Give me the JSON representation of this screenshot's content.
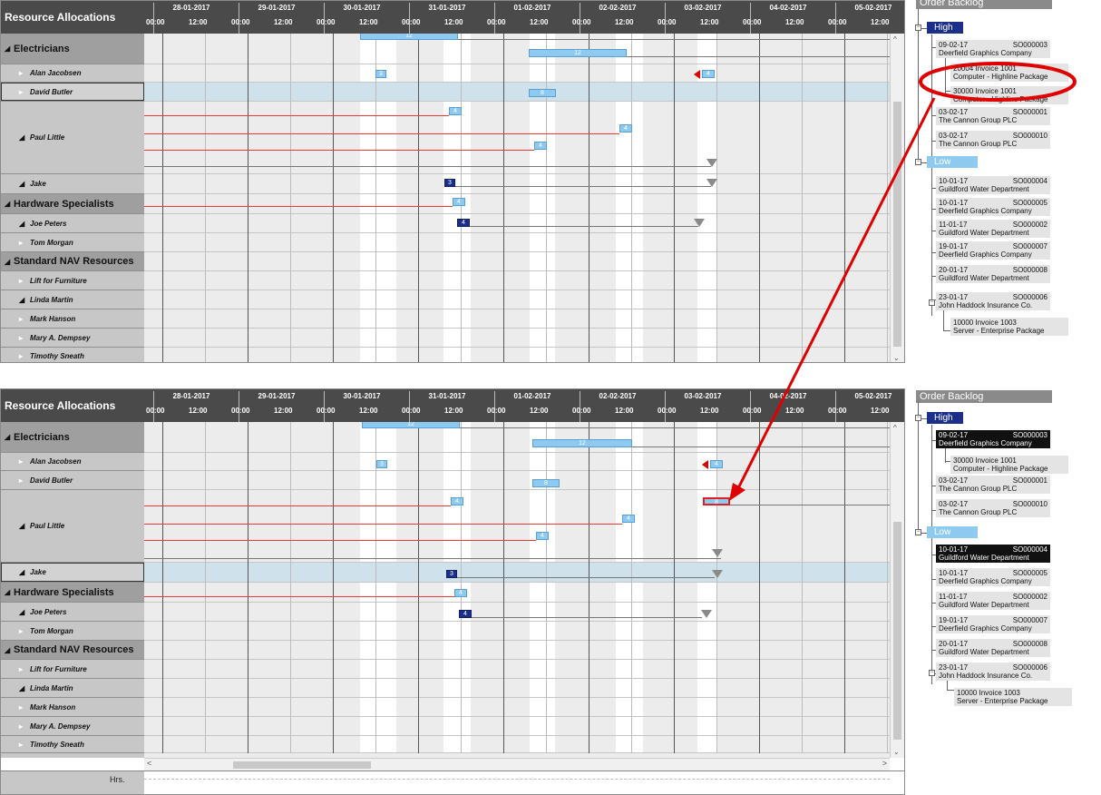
{
  "top": {
    "resource_header": "Resource Allocations",
    "day_labels": [
      "28-01-2017",
      "29-01-2017",
      "30-01-2017",
      "31-01-2017",
      "01-02-2017",
      "02-02-2017",
      "03-02-2017",
      "04-02-2017",
      "05-02-2017"
    ],
    "time_labels": [
      "00:00",
      "12:00",
      "00:00",
      "12:00",
      "00:00",
      "12:00",
      "00:00",
      "12:00",
      "00:00",
      "12:00",
      "00:00",
      "12:00",
      "00:00",
      "12:00",
      "00:00",
      "12:00",
      "00:00",
      "12:00"
    ],
    "rows": [
      {
        "label": "Electricians",
        "kind": "group"
      },
      {
        "label": "Alan Jacobsen",
        "kind": "res"
      },
      {
        "label": "David Butler",
        "kind": "res",
        "selected": true
      },
      {
        "label": "Paul Little",
        "kind": "parent"
      },
      {
        "label": "Jake",
        "kind": "parent"
      },
      {
        "label": "Hardware Specialists",
        "kind": "group"
      },
      {
        "label": "Joe Peters",
        "kind": "parent"
      },
      {
        "label": "Tom Morgan",
        "kind": "res"
      },
      {
        "label": "Standard NAV Resources",
        "kind": "group"
      },
      {
        "label": "Lift for Furniture",
        "kind": "res"
      },
      {
        "label": "Linda Martin",
        "kind": "parent"
      },
      {
        "label": "Mark Hanson",
        "kind": "res"
      },
      {
        "label": "Mary A. Dempsey",
        "kind": "res"
      },
      {
        "label": "Timothy Sneath",
        "kind": "res"
      }
    ],
    "bars": [
      "12",
      "12",
      "3",
      "4",
      "8",
      "4",
      "4",
      "4",
      "3",
      "4",
      "4"
    ]
  },
  "bottom": {
    "resource_header": "Resource Allocations",
    "day_labels": [
      "28-01-2017",
      "29-01-2017",
      "30-01-2017",
      "31-01-2017",
      "01-02-2017",
      "02-02-2017",
      "03-02-2017",
      "04-02-2017",
      "05-02-2017"
    ],
    "time_labels": [
      "00:00",
      "12:00",
      "00:00",
      "12:00",
      "00:00",
      "12:00",
      "00:00",
      "12:00",
      "00:00",
      "12:00",
      "00:00",
      "12:00",
      "00:00",
      "12:00",
      "00:00",
      "12:00",
      "00:00",
      "12:00"
    ],
    "rows": [
      {
        "label": "Electricians",
        "kind": "group"
      },
      {
        "label": "Alan Jacobsen",
        "kind": "res"
      },
      {
        "label": "David Butler",
        "kind": "res"
      },
      {
        "label": "Paul Little",
        "kind": "parent"
      },
      {
        "label": "Jake",
        "kind": "parent",
        "selected": true
      },
      {
        "label": "Hardware Specialists",
        "kind": "group"
      },
      {
        "label": "Joe Peters",
        "kind": "parent"
      },
      {
        "label": "Tom Morgan",
        "kind": "res"
      },
      {
        "label": "Standard NAV Resources",
        "kind": "group"
      },
      {
        "label": "Lift for Furniture",
        "kind": "res"
      },
      {
        "label": "Linda Martin",
        "kind": "parent"
      },
      {
        "label": "Mark Hanson",
        "kind": "res"
      },
      {
        "label": "Mary A. Dempsey",
        "kind": "res"
      },
      {
        "label": "Timothy Sneath",
        "kind": "res"
      }
    ],
    "bars": [
      "12",
      "12",
      "3",
      "4",
      "8",
      "4",
      "4",
      "4",
      "8",
      "3",
      "4",
      "4"
    ],
    "hours_label": "Hrs."
  },
  "backlog_top": {
    "title": "Order Backlog",
    "high_label": "High",
    "low_label": "Low",
    "orders": [
      {
        "date": "09-02-17",
        "so": "SO000003",
        "customer": "Deerfield Graphics Company"
      },
      {
        "date": "03-02-17",
        "so": "SO000001",
        "customer": "The Cannon Group PLC"
      },
      {
        "date": "03-02-17",
        "so": "SO000010",
        "customer": "The Cannon Group PLC"
      },
      {
        "date": "10-01-17",
        "so": "SO000004",
        "customer": "Guildford Water Department"
      },
      {
        "date": "10-01-17",
        "so": "SO000005",
        "customer": "Deerfield Graphics Company"
      },
      {
        "date": "11-01-17",
        "so": "SO000002",
        "customer": "Guildford Water Department"
      },
      {
        "date": "19-01-17",
        "so": "SO000007",
        "customer": "Deerfield Graphics Company"
      },
      {
        "date": "20-01-17",
        "so": "SO000008",
        "customer": "Guildford Water Department"
      },
      {
        "date": "23-01-17",
        "so": "SO000006",
        "customer": "John Haddock Insurance Co."
      }
    ],
    "invoices": [
      {
        "line1": "20004   Invoice 1001",
        "line2": "Computer - Highline Package"
      },
      {
        "line1": "30000   Invoice 1001",
        "line2": "Computer - Highline Package"
      },
      {
        "line1": "10000   Invoice 1003",
        "line2": "Server - Enterprise Package"
      }
    ]
  },
  "backlog_bottom": {
    "title": "Order Backlog",
    "high_label": "High",
    "low_label": "Low",
    "orders": [
      {
        "date": "09-02-17",
        "so": "SO000003",
        "customer": "Deerfield Graphics Company"
      },
      {
        "date": "03-02-17",
        "so": "SO000001",
        "customer": "The Cannon Group PLC"
      },
      {
        "date": "03-02-17",
        "so": "SO000010",
        "customer": "The Cannon Group PLC"
      },
      {
        "date": "10-01-17",
        "so": "SO000004",
        "customer": "Guildford Water Department"
      },
      {
        "date": "10-01-17",
        "so": "SO000005",
        "customer": "Deerfield Graphics Company"
      },
      {
        "date": "11-01-17",
        "so": "SO000002",
        "customer": "Guildford Water Department"
      },
      {
        "date": "19-01-17",
        "so": "SO000007",
        "customer": "Deerfield Graphics Company"
      },
      {
        "date": "20-01-17",
        "so": "SO000008",
        "customer": "Guildford Water Department"
      },
      {
        "date": "23-01-17",
        "so": "SO000006",
        "customer": "John Haddock Insurance Co."
      }
    ],
    "invoices": [
      {
        "line1": "30000   Invoice 1001",
        "line2": "Computer - Highline Package"
      },
      {
        "line1": "10000   Invoice 1003",
        "line2": "Server - Enterprise Package"
      }
    ]
  },
  "colors": {
    "header_bg": "#4a4a4a",
    "bar_light": "#8ec9f0",
    "bar_dark": "#1b2f8a",
    "annotation_red": "#e00000",
    "selected_row": "#cfe1ea"
  }
}
